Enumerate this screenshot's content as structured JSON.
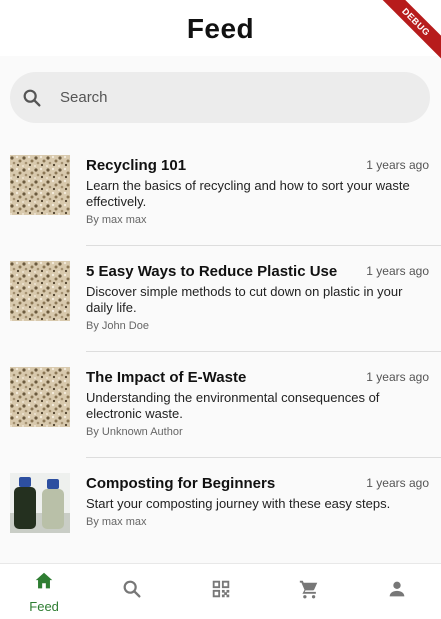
{
  "appbar": {
    "title": "Feed",
    "debug_label": "DEBUG"
  },
  "search": {
    "placeholder": "Search",
    "icon": "search-icon"
  },
  "feed": [
    {
      "title": "Recycling 101",
      "age": "1 years ago",
      "description": "Learn the basics of recycling and how to sort your waste effectively.",
      "author": "By max max",
      "thumb": "gravel"
    },
    {
      "title": "5 Easy Ways to Reduce Plastic Use",
      "age": "1 years ago",
      "description": "Discover simple methods to cut down on plastic in your daily life.",
      "author": "By John Doe",
      "thumb": "gravel"
    },
    {
      "title": "The Impact of E-Waste",
      "age": "1 years ago",
      "description": "Understanding the environmental consequences of electronic waste.",
      "author": "By Unknown Author",
      "thumb": "gravel"
    },
    {
      "title": "Composting for Beginners",
      "age": "1 years ago",
      "description": "Start your composting journey with these easy steps.",
      "author": "By max max",
      "thumb": "bottles"
    }
  ],
  "bottom_nav": [
    {
      "label": "Feed",
      "icon": "home-icon",
      "active": true
    },
    {
      "label": "",
      "icon": "search-icon",
      "active": false
    },
    {
      "label": "",
      "icon": "qr-code-icon",
      "active": false
    },
    {
      "label": "",
      "icon": "cart-icon",
      "active": false
    },
    {
      "label": "",
      "icon": "person-icon",
      "active": false
    }
  ],
  "colors": {
    "accent": "#2e7d32",
    "debug": "#b71c1c",
    "search_bg": "#ececec"
  }
}
